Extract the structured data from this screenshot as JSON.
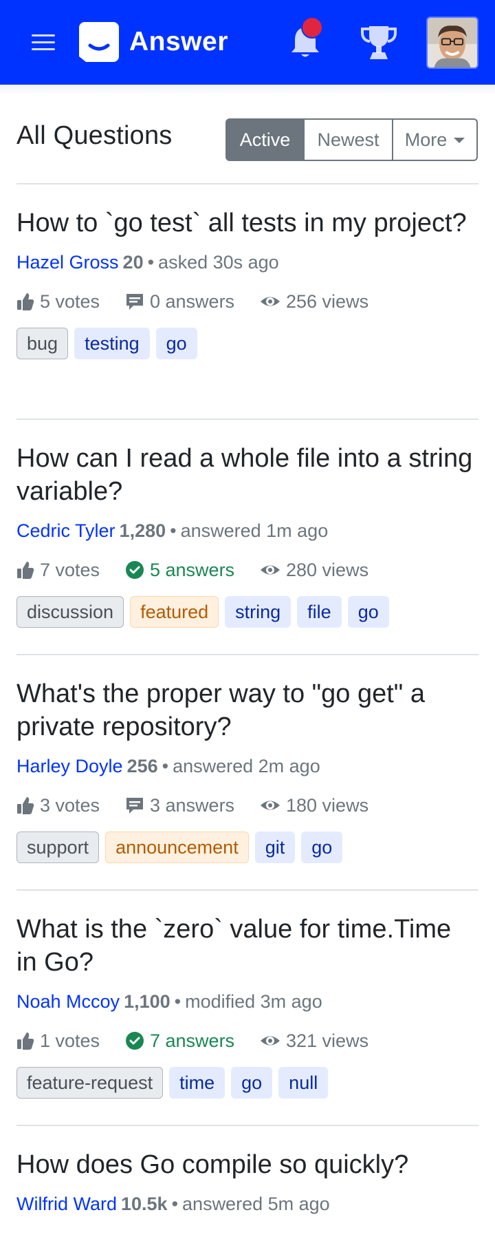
{
  "header": {
    "brand_name": "Answer",
    "brand_color": "#0033ff",
    "icons": [
      "menu-icon",
      "answer-logo-icon",
      "bell-icon",
      "trophy-icon",
      "avatar"
    ],
    "notification_dot_color": "#e0263f"
  },
  "page": {
    "title": "All Questions",
    "filters": {
      "active_label": "Active",
      "newest_label": "Newest",
      "more_label": "More",
      "selected": "Active"
    }
  },
  "questions": [
    {
      "title": "How to `go test` all tests in my project?",
      "author": "Hazel Gross",
      "reputation": "20",
      "action": "asked 30s ago",
      "votes": "5 votes",
      "answers": "0 answers",
      "answers_accepted": false,
      "views": "256 views",
      "tags": [
        {
          "name": "bug",
          "style": "gray"
        },
        {
          "name": "testing",
          "style": "blue"
        },
        {
          "name": "go",
          "style": "blue"
        }
      ]
    },
    {
      "title": "How can I read a whole file into a string variable?",
      "author": "Cedric Tyler",
      "reputation": "1,280",
      "action": "answered 1m ago",
      "votes": "7 votes",
      "answers": "5 answers",
      "answers_accepted": true,
      "views": "280 views",
      "tags": [
        {
          "name": "discussion",
          "style": "gray"
        },
        {
          "name": "featured",
          "style": "orange"
        },
        {
          "name": "string",
          "style": "blue"
        },
        {
          "name": "file",
          "style": "blue"
        },
        {
          "name": "go",
          "style": "blue"
        }
      ]
    },
    {
      "title": "What's the proper way to \"go get\" a private repository?",
      "author": "Harley Doyle",
      "reputation": "256",
      "action": "answered 2m ago",
      "votes": "3 votes",
      "answers": "3 answers",
      "answers_accepted": false,
      "views": "180 views",
      "tags": [
        {
          "name": "support",
          "style": "gray"
        },
        {
          "name": "announcement",
          "style": "orange"
        },
        {
          "name": "git",
          "style": "blue"
        },
        {
          "name": "go",
          "style": "blue"
        }
      ]
    },
    {
      "title": "What is the `zero` value for time.Time in Go?",
      "author": "Noah Mccoy",
      "reputation": "1,100",
      "action": "modified 3m ago",
      "votes": "1 votes",
      "answers": "7 answers",
      "answers_accepted": true,
      "views": "321 views",
      "tags": [
        {
          "name": "feature-request",
          "style": "gray"
        },
        {
          "name": "time",
          "style": "blue"
        },
        {
          "name": "go",
          "style": "blue"
        },
        {
          "name": "null",
          "style": "blue"
        }
      ]
    },
    {
      "title": "How does Go compile so quickly?",
      "author": "Wilfrid Ward",
      "reputation": "10.5k",
      "action": "answered 5m ago"
    }
  ],
  "colors": {
    "link": "#0033ff",
    "muted": "#6c757d",
    "success": "#198754",
    "tag_blue_bg": "#e4ebff",
    "tag_orange_bg": "#fff0e0",
    "tag_gray_bg": "#e9ecef"
  }
}
